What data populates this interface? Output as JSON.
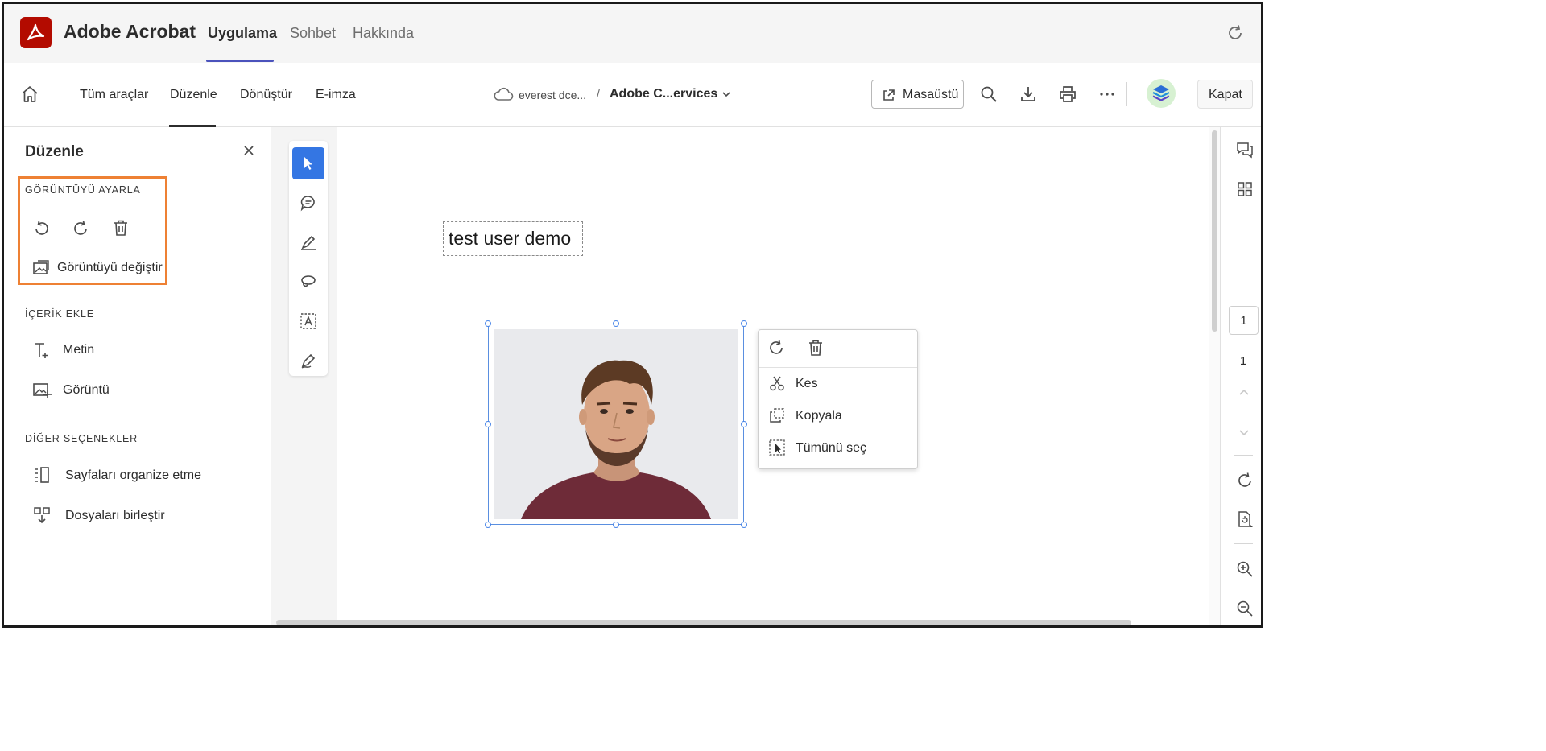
{
  "app": {
    "name": "Adobe Acrobat",
    "tabs": [
      "Uygulama",
      "Sohbet",
      "Hakkında"
    ],
    "active_tab": "Uygulama"
  },
  "toolbar": {
    "tabs": [
      "Tüm araçlar",
      "Düzenle",
      "Dönüştür",
      "E-imza"
    ],
    "active_tab": "Düzenle",
    "breadcrumb_location": "everest dce...",
    "breadcrumb_separator": "/",
    "document_name": "Adobe C...ervices",
    "desktop_label": "Masaüstü",
    "close_label": "Kapat"
  },
  "panel": {
    "title": "Düzenle",
    "sections": [
      {
        "title": "GÖRÜNTÜYÜ AYARLA",
        "items": [
          "Görüntüyü değiştir"
        ]
      },
      {
        "title": "İÇERİK EKLE",
        "items": [
          "Metin",
          "Görüntü"
        ]
      },
      {
        "title": "DİĞER SEÇENEKLER",
        "items": [
          "Sayfaları organize etme",
          "Dosyaları birleştir"
        ]
      }
    ]
  },
  "canvas": {
    "text_box": "test user demo"
  },
  "context_menu": {
    "items": [
      "Kes",
      "Kopyala",
      "Tümünü seç"
    ]
  },
  "page_nav": {
    "current": "1",
    "total": "1"
  },
  "colors": {
    "brand": "#b30b00",
    "tab_accent": "#4b53bc",
    "selected_tool": "#3476e3",
    "highlight": "#ee8134",
    "selection": "#4a86e8"
  }
}
